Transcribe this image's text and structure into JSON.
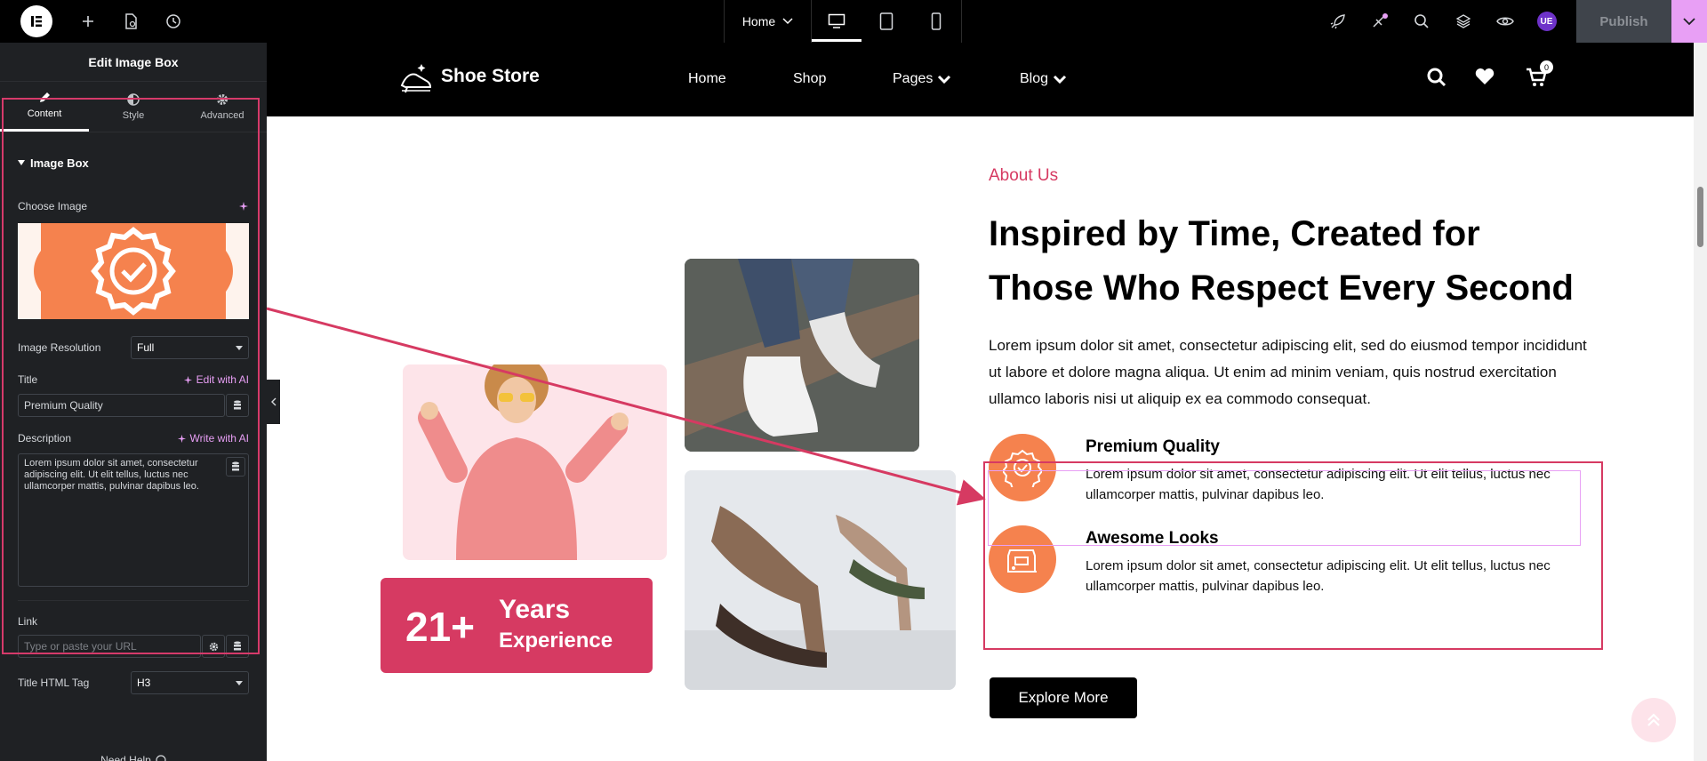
{
  "topbar": {
    "page_selector": "Home",
    "publish_label": "Publish",
    "avatar_initials": "UE"
  },
  "panel": {
    "title": "Edit Image Box",
    "tabs": [
      {
        "label": "Content",
        "icon": "pencil-icon"
      },
      {
        "label": "Style",
        "icon": "half-circle-icon"
      },
      {
        "label": "Advanced",
        "icon": "gear-icon"
      }
    ],
    "section_title": "Image Box",
    "choose_image_label": "Choose Image",
    "resolution_label": "Image Resolution",
    "resolution_value": "Full",
    "title_label": "Title",
    "title_ai": "Edit with AI",
    "title_value": "Premium Quality",
    "description_label": "Description",
    "description_ai": "Write with AI",
    "description_value": "Lorem ipsum dolor sit amet, consectetur adipiscing elit. Ut elit tellus, luctus nec ullamcorper mattis, pulvinar dapibus leo.",
    "link_label": "Link",
    "link_placeholder": "Type or paste your URL",
    "tag_label": "Title HTML Tag",
    "tag_value": "H3",
    "help_text": "Need Help"
  },
  "site": {
    "brand": "Shoe Store",
    "nav": [
      "Home",
      "Shop",
      "Pages",
      "Blog"
    ],
    "cart_count": "0",
    "experience_number": "21+",
    "experience_line1": "Years",
    "experience_line2": "Experience",
    "about_label": "About Us",
    "headline_line1": "Inspired by Time, Created for",
    "headline_line2": "Those Who Respect Every Second",
    "paragraph": "Lorem ipsum dolor sit amet, consectetur adipiscing elit, sed do eiusmod tempor incididunt ut labore et dolore magna aliqua. Ut enim ad minim veniam, quis nostrud exercitation ullamco laboris nisi ut aliquip ex ea commodo consequat.",
    "features": [
      {
        "title": "Premium Quality",
        "desc": "Lorem ipsum dolor sit amet, consectetur adipiscing elit. Ut elit tellus, luctus nec ullamcorper mattis, pulvinar dapibus leo.",
        "icon": "badge-check-icon"
      },
      {
        "title": "Awesome Looks",
        "desc": "Lorem ipsum dolor sit amet, consectetur adipiscing elit. Ut elit tellus, luctus nec ullamcorper mattis, pulvinar dapibus leo.",
        "icon": "shoe-box-icon"
      }
    ],
    "cta": "Explore More"
  },
  "colors": {
    "accent": "#d63a62",
    "orange": "#f5824e",
    "ai_pink": "#e89ff5"
  }
}
